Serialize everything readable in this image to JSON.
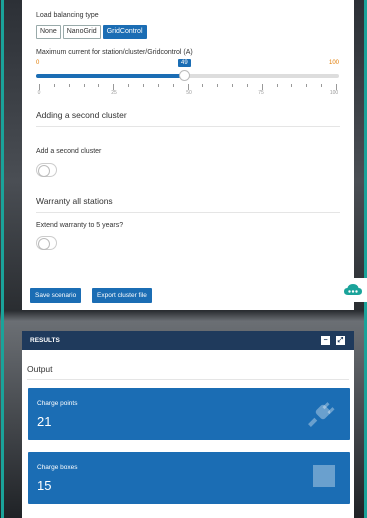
{
  "settings": {
    "load_balancing_label": "Load balancing type",
    "load_balancing_options": [
      "None",
      "NanoGrid",
      "GridControl"
    ],
    "load_balancing_selected": "GridControl",
    "max_current_label": "Maximum current for station/cluster/Gridcontrol (A)",
    "slider": {
      "min": "0",
      "max": "100",
      "value": "49",
      "value_fraction": 0.49,
      "tick_labels": [
        "0",
        "25",
        "50",
        "75",
        "100"
      ]
    },
    "second_cluster_title": "Adding a second cluster",
    "second_cluster_toggle_label": "Add a second cluster",
    "second_cluster_enabled": false,
    "warranty_title": "Warranty all stations",
    "warranty_toggle_label": "Extend warranty to 5 years?",
    "warranty_enabled": false,
    "save_label": "Save scenario",
    "export_label": "Export cluster file"
  },
  "results": {
    "header": "RESULTS",
    "output_title": "Output",
    "cards": [
      {
        "label": "Charge points",
        "value": "21",
        "icon": "plug-icon"
      },
      {
        "label": "Charge boxes",
        "value": "15",
        "icon": "box-icon"
      }
    ]
  },
  "colors": {
    "accent": "#1b6db4",
    "frame": "#1aa39a",
    "header": "#1f3a5c",
    "slider_minmax": "#e07a00"
  }
}
